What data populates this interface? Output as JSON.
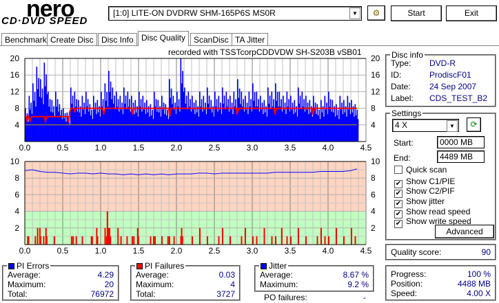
{
  "app": {
    "logo_top": "nero",
    "logo_bottom": "CD·DVD SPEED"
  },
  "toolbar": {
    "drive": "[1:0]  LITE-ON DVDRW SHM-165P6S MS0R",
    "start_label": "Start",
    "exit_label": "Exit"
  },
  "tabs": [
    {
      "label": "Benchmark"
    },
    {
      "label": "Create Disc"
    },
    {
      "label": "Disc Info"
    },
    {
      "label": "Disc Quality",
      "active": true
    },
    {
      "label": "ScanDisc"
    },
    {
      "label": "TA Jitter"
    }
  ],
  "recorded_with": "recorded with TSSTcorpCDDVDW SH-S203B  vSB01",
  "disc_info": {
    "title": "Disc info",
    "type_label": "Type:",
    "type": "DVD-R",
    "id_label": "ID:",
    "id": "ProdiscF01",
    "date_label": "Date:",
    "date": "24 Sep 2007",
    "label_label": "Label:",
    "label": "CDS_TEST_B2"
  },
  "settings": {
    "title": "Settings",
    "speed": "4 X",
    "start_label": "Start:",
    "start": "0000 MB",
    "end_label": "End:",
    "end": "4489 MB",
    "checks": [
      {
        "label": "Quick scan",
        "checked": false
      },
      {
        "label": "Show C1/PIE",
        "checked": true
      },
      {
        "label": "Show C2/PIF",
        "checked": true
      },
      {
        "label": "Show jitter",
        "checked": true
      },
      {
        "label": "Show read speed",
        "checked": true
      },
      {
        "label": "Show write speed",
        "checked": true
      }
    ],
    "advanced_label": "Advanced"
  },
  "quality": {
    "label": "Quality score:",
    "value": "90"
  },
  "progress": {
    "progress_label": "Progress:",
    "progress": "100 %",
    "position_label": "Position:",
    "position": "4488 MB",
    "speed_label": "Speed:",
    "speed": "4.00 X"
  },
  "pi_errors": {
    "title": "PI Errors",
    "avg_label": "Average:",
    "avg": "4.29",
    "max_label": "Maximum:",
    "max": "20",
    "total_label": "Total:",
    "total": "76972",
    "color": "#0000ff"
  },
  "pi_failures": {
    "title": "PI Failures",
    "avg_label": "Average:",
    "avg": "0.03",
    "max_label": "Maximum:",
    "max": "4",
    "total_label": "Total:",
    "total": "3727",
    "color": "#ff0000"
  },
  "jitter": {
    "title": "Jitter",
    "avg_label": "Average:",
    "avg": "8.67 %",
    "max_label": "Maximum:",
    "max": "9.2 %",
    "color": "#0000ff"
  },
  "po_failures": {
    "label": "PO failures:",
    "value": "-"
  },
  "chart_data": [
    {
      "type": "bar",
      "name": "PI errors / read speed",
      "xlim": [
        0,
        4.5
      ],
      "ylim": [
        0,
        20
      ],
      "x_ticks": [
        "0.0",
        "0.5",
        "1.0",
        "1.5",
        "2.0",
        "2.5",
        "3.0",
        "3.5",
        "4.0",
        "4.5"
      ],
      "y_ticks_left": [
        "4",
        "8",
        "12",
        "16",
        "20"
      ],
      "y_ticks_right": [
        "4",
        "8",
        "12",
        "16",
        "20"
      ],
      "pie_step": 0.05,
      "pie": [
        8,
        11,
        14,
        18,
        15,
        19,
        12,
        10,
        12,
        9,
        8,
        7,
        13,
        12,
        10,
        11,
        12,
        9,
        11,
        10,
        12,
        14,
        17,
        13,
        12,
        11,
        13,
        12,
        11,
        10,
        12,
        11,
        10,
        9,
        12,
        10,
        11,
        9,
        15,
        11,
        12,
        20,
        13,
        12,
        11,
        10,
        12,
        11,
        13,
        10,
        12,
        11,
        13,
        12,
        11,
        12,
        15,
        12,
        11,
        12,
        14,
        12,
        11,
        10,
        13,
        12,
        14,
        12,
        11,
        12,
        11,
        10,
        13,
        12,
        11,
        10,
        11,
        9,
        10,
        11,
        12,
        10,
        9,
        11,
        10,
        11,
        10,
        9
      ],
      "read_speed": [
        [
          0,
          6
        ],
        [
          0.02,
          6
        ],
        [
          0.03,
          5
        ],
        [
          0.05,
          6
        ],
        [
          0.07,
          5
        ],
        [
          0.09,
          6
        ],
        [
          0.26,
          6
        ],
        [
          0.27,
          5
        ],
        [
          0.29,
          6
        ],
        [
          0.57,
          6
        ],
        [
          0.58,
          4.5
        ],
        [
          0.59,
          7
        ],
        [
          0.61,
          8
        ],
        [
          0.65,
          8
        ],
        [
          0.66,
          7
        ],
        [
          0.67,
          8
        ],
        [
          1.03,
          8
        ],
        [
          1.04,
          6.5
        ],
        [
          1.06,
          8
        ],
        [
          1.41,
          8
        ],
        [
          1.42,
          6.5
        ],
        [
          1.44,
          8
        ],
        [
          1.9,
          8
        ],
        [
          1.91,
          6
        ],
        [
          1.93,
          8
        ],
        [
          2.79,
          8
        ],
        [
          2.8,
          6.5
        ],
        [
          2.82,
          8
        ],
        [
          3.29,
          8
        ],
        [
          3.3,
          6.5
        ],
        [
          3.32,
          8
        ],
        [
          3.79,
          8
        ],
        [
          3.8,
          6.5
        ],
        [
          3.82,
          8
        ],
        [
          4.38,
          8
        ]
      ],
      "write_speed": [
        [
          0,
          4
        ],
        [
          4.38,
          4
        ]
      ],
      "colors": {
        "pie": "#0000ff",
        "read": "#ff0000",
        "write": "#c8a000"
      }
    },
    {
      "type": "bar",
      "name": "PI failures / jitter",
      "xlim": [
        0,
        4.5
      ],
      "ylim": [
        0,
        10
      ],
      "x_ticks": [
        "0.0",
        "0.5",
        "1.0",
        "1.5",
        "2.0",
        "2.5",
        "3.0",
        "3.5",
        "4.0",
        "4.5"
      ],
      "y_ticks_left": [
        "2",
        "4",
        "6",
        "8",
        "10"
      ],
      "y_ticks_right": [
        "2",
        "4",
        "6",
        "8",
        "10"
      ],
      "jitter": [
        [
          0,
          8.9
        ],
        [
          0.1,
          9.0
        ],
        [
          0.2,
          8.8
        ],
        [
          0.3,
          8.7
        ],
        [
          0.4,
          8.7
        ],
        [
          0.5,
          8.6
        ],
        [
          0.6,
          8.5
        ],
        [
          0.7,
          8.6
        ],
        [
          0.8,
          8.6
        ],
        [
          0.9,
          8.5
        ],
        [
          1.0,
          8.6
        ],
        [
          1.1,
          8.5
        ],
        [
          1.2,
          8.5
        ],
        [
          1.3,
          8.4
        ],
        [
          1.4,
          8.5
        ],
        [
          1.5,
          8.4
        ],
        [
          1.6,
          8.5
        ],
        [
          1.7,
          8.4
        ],
        [
          1.8,
          8.5
        ],
        [
          1.9,
          8.4
        ],
        [
          2.0,
          8.5
        ],
        [
          2.1,
          8.5
        ],
        [
          2.2,
          8.5
        ],
        [
          2.3,
          8.6
        ],
        [
          2.4,
          8.6
        ],
        [
          2.5,
          8.5
        ],
        [
          2.6,
          8.6
        ],
        [
          2.7,
          8.6
        ],
        [
          2.8,
          8.6
        ],
        [
          2.9,
          8.6
        ],
        [
          3.0,
          8.6
        ],
        [
          3.1,
          8.6
        ],
        [
          3.2,
          8.6
        ],
        [
          3.3,
          8.7
        ],
        [
          3.4,
          8.7
        ],
        [
          3.5,
          8.7
        ],
        [
          3.6,
          8.7
        ],
        [
          3.7,
          8.7
        ],
        [
          3.8,
          8.7
        ],
        [
          3.9,
          8.8
        ],
        [
          4.0,
          8.8
        ],
        [
          4.1,
          8.8
        ],
        [
          4.2,
          8.8
        ],
        [
          4.3,
          8.9
        ],
        [
          4.38,
          9.1
        ]
      ],
      "pif": [
        [
          0.03,
          1
        ],
        [
          0.04,
          1
        ],
        [
          0.13,
          1
        ],
        [
          0.16,
          2
        ],
        [
          0.19,
          2
        ],
        [
          0.2,
          1
        ],
        [
          0.24,
          1
        ],
        [
          0.27,
          2
        ],
        [
          0.28,
          1
        ],
        [
          0.38,
          1
        ],
        [
          0.61,
          1
        ],
        [
          0.63,
          1
        ],
        [
          0.67,
          1
        ],
        [
          0.75,
          1
        ],
        [
          0.87,
          1
        ],
        [
          0.88,
          1
        ],
        [
          0.94,
          2
        ],
        [
          0.95,
          1
        ],
        [
          1.05,
          2
        ],
        [
          1.07,
          1
        ],
        [
          1.08,
          4
        ],
        [
          1.09,
          2
        ],
        [
          1.1,
          2
        ],
        [
          1.11,
          2
        ],
        [
          1.12,
          1
        ],
        [
          1.22,
          2
        ],
        [
          1.26,
          1
        ],
        [
          1.34,
          1
        ],
        [
          1.41,
          1
        ],
        [
          1.43,
          1
        ],
        [
          1.48,
          2
        ],
        [
          1.49,
          1
        ],
        [
          1.65,
          1
        ],
        [
          1.69,
          1
        ],
        [
          1.71,
          1
        ],
        [
          1.8,
          1
        ],
        [
          1.88,
          1
        ],
        [
          1.9,
          1
        ],
        [
          1.96,
          1
        ],
        [
          2.05,
          1
        ],
        [
          2.06,
          2
        ],
        [
          2.07,
          1
        ],
        [
          2.2,
          1
        ],
        [
          2.3,
          2
        ],
        [
          2.4,
          1
        ],
        [
          2.55,
          1
        ],
        [
          2.6,
          2
        ],
        [
          2.7,
          1
        ],
        [
          2.85,
          1
        ],
        [
          2.9,
          2
        ],
        [
          3.0,
          1
        ],
        [
          3.05,
          1
        ],
        [
          3.15,
          2
        ],
        [
          3.25,
          1
        ],
        [
          3.3,
          1
        ],
        [
          3.38,
          2
        ],
        [
          3.45,
          1
        ],
        [
          3.5,
          1
        ],
        [
          3.6,
          2
        ],
        [
          3.7,
          1
        ],
        [
          3.85,
          1
        ],
        [
          3.9,
          2
        ],
        [
          3.95,
          1
        ],
        [
          4.0,
          1
        ],
        [
          4.1,
          2
        ],
        [
          4.2,
          1
        ],
        [
          4.3,
          2
        ],
        [
          4.35,
          1
        ]
      ],
      "zones": {
        "good_max": 4,
        "good_color": "#c0ffc0",
        "bad_color": "#ffd4c0"
      },
      "colors": {
        "jitter": "#0000ff",
        "pif": "#ff0000"
      }
    }
  ]
}
